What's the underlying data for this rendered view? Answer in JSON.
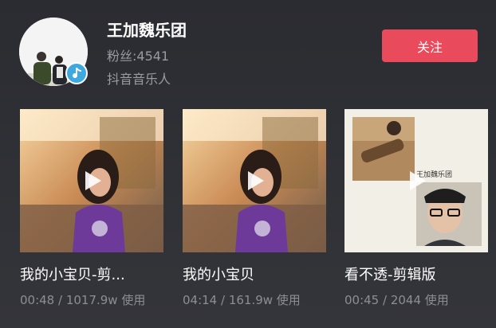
{
  "header": {
    "artist_name": "王加魏乐团",
    "fans": "粉丝:4541",
    "role": "抖音音乐人",
    "follow_label": "关注"
  },
  "songs": [
    {
      "title": "我的小宝贝-剪...",
      "meta": "00:48 / 1017.9w 使用"
    },
    {
      "title": "我的小宝贝",
      "meta": "04:14 / 161.9w 使用"
    },
    {
      "title": "看不透-剪辑版",
      "meta": "00:45 / 2044 使用",
      "cover_text": "王加魏乐团"
    }
  ],
  "colors": {
    "accent": "#e94b5c",
    "badge": "#3ea8df",
    "secondary_text": "#9a9ba0"
  },
  "icons": {
    "badge": "music-note-icon",
    "play": "play-icon"
  }
}
